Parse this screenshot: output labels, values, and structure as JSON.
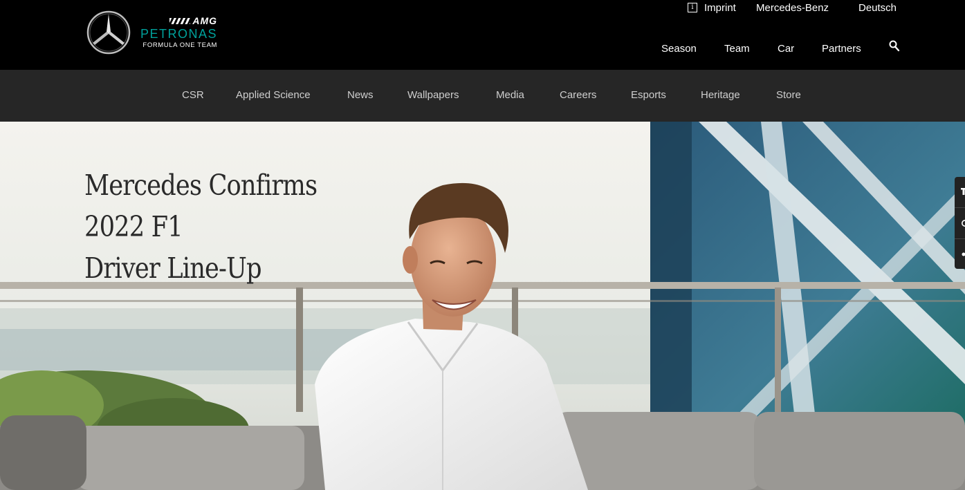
{
  "header": {
    "logo": {
      "amg": "AMG",
      "petronas": "PETRONAS",
      "team": "FORMULA ONE TEAM",
      "icon": "mercedes-star-icon"
    },
    "utility": {
      "imprint": "Imprint",
      "mercedes_benz": "Mercedes-Benz",
      "language": "Deutsch",
      "imprint_icon": "info-icon"
    },
    "main_nav": [
      "Season",
      "Team",
      "Car",
      "Partners"
    ],
    "search_icon": "search-icon"
  },
  "secondary_nav": [
    "CSR",
    "Applied Science",
    "News",
    "Wallpapers",
    "Media",
    "Careers",
    "Esports",
    "Heritage",
    "Store"
  ],
  "hero": {
    "headline_line1": "Mercedes Confirms 2022 F1",
    "headline_line2": "Driver Line-Up"
  },
  "share_bar": {
    "icons": [
      "twitter-icon",
      "whatsapp-icon",
      "share-icon"
    ]
  },
  "colors": {
    "header_bg": "#000000",
    "subnav_bg": "#262626",
    "petronas_teal": "#00a19b",
    "headline": "#2a2a2a"
  }
}
